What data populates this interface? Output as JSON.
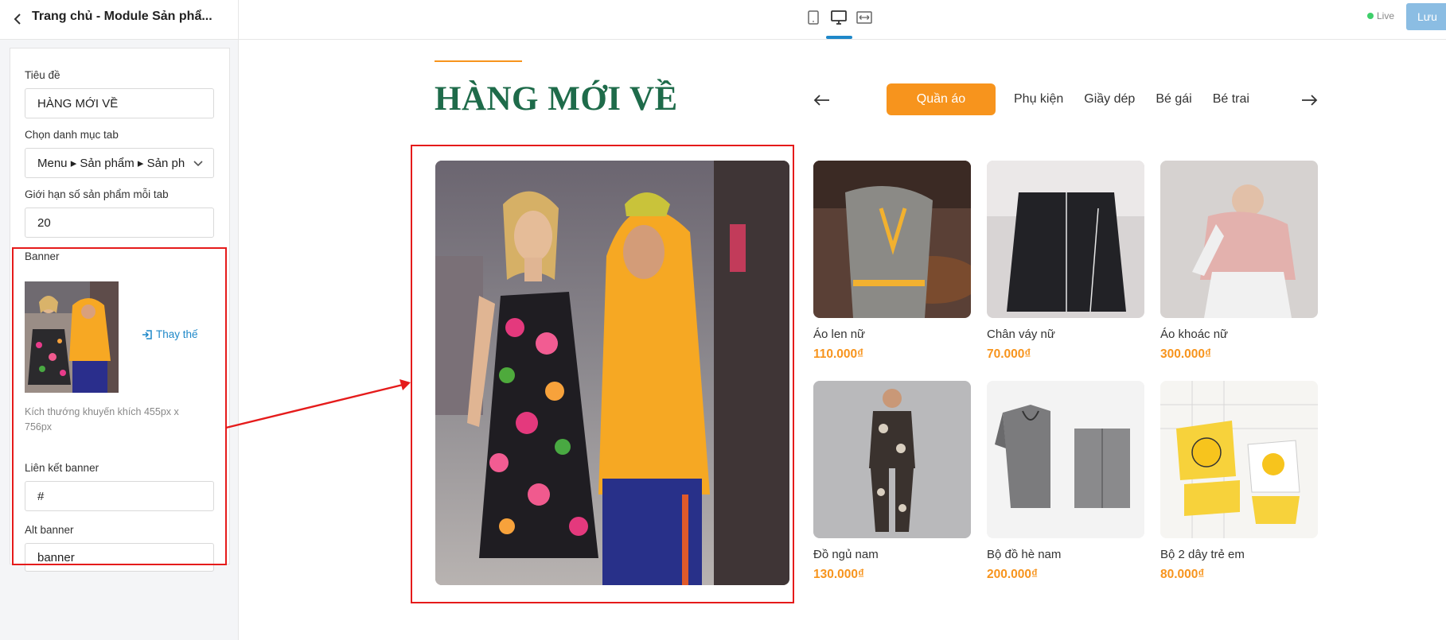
{
  "topbar": {
    "title": "Trang chủ - Module Sản phẩ...",
    "live_label": "Live",
    "save_label": "Lưu",
    "colors": {
      "accent": "#1e88c9",
      "live": "#3ecf6a",
      "save_bg": "#8bbde3"
    }
  },
  "settings": {
    "title_label": "Tiêu đề",
    "title_value": "HÀNG MỚI VỀ",
    "tab_category_label": "Chọn danh mục tab",
    "tab_category_value": "Menu ▸ Sản phẩm ▸ Sản ph",
    "limit_label": "Giới hạn số sản phẩm mỗi tab",
    "limit_value": "20",
    "banner_label": "Banner",
    "replace_label": "Thay thế",
    "banner_hint": "Kích thướng khuyến khích 455px x 756px",
    "link_label": "Liên kết banner",
    "link_value": "#",
    "alt_label": "Alt banner",
    "alt_value": "banner"
  },
  "preview": {
    "section_title": "HÀNG MỚI VỀ",
    "tabs": [
      {
        "label": "Quần áo",
        "active": true
      },
      {
        "label": "Phụ kiện",
        "active": false
      },
      {
        "label": "Giầy dép",
        "active": false
      },
      {
        "label": "Bé gái",
        "active": false
      },
      {
        "label": "Bé trai",
        "active": false
      }
    ],
    "products": [
      {
        "name": "Áo len nữ",
        "price": "110.000₫"
      },
      {
        "name": "Chân váy nữ",
        "price": "70.000₫"
      },
      {
        "name": "Áo khoác nữ",
        "price": "300.000₫"
      },
      {
        "name": "Đồ ngủ nam",
        "price": "130.000₫"
      },
      {
        "name": "Bộ đồ hè nam",
        "price": "200.000₫"
      },
      {
        "name": "Bộ 2 dây trẻ em",
        "price": "80.000₫"
      }
    ],
    "colors": {
      "title": "#1e6b4a",
      "tab_active": "#f7941d",
      "price": "#f7941d",
      "highlight": "#e51b1b"
    }
  }
}
